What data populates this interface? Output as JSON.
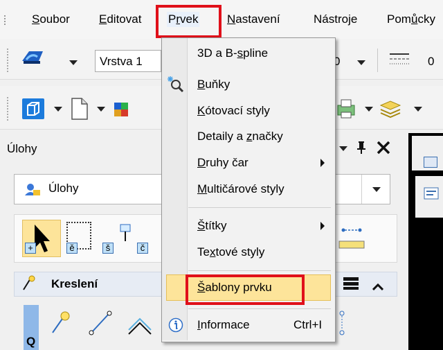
{
  "menubar": {
    "items": [
      {
        "pre": "",
        "u": "S",
        "post": "oubor"
      },
      {
        "pre": "",
        "u": "E",
        "post": "ditovat"
      },
      {
        "pre": "P",
        "u": "r",
        "post": "vek"
      },
      {
        "pre": "",
        "u": "N",
        "post": "astavení"
      },
      {
        "pre": "Nástro",
        "u": "j",
        "post": "e"
      },
      {
        "pre": "Pom",
        "u": "ů",
        "post": "cky"
      }
    ]
  },
  "toolbar1": {
    "layer_combo": "Vrstva 1",
    "value_a": "0",
    "value_b": "0"
  },
  "panel": {
    "title": "Úlohy",
    "combo_value": "Úlohy",
    "tool_labels": [
      "+",
      "ě",
      "š",
      "č"
    ],
    "section_title": "Kreslení",
    "bottom_letter": "Q"
  },
  "menu": {
    "items": [
      {
        "pre": "3D a B-",
        "u": "s",
        "post": "pline",
        "shortcut": "",
        "submenu": false
      },
      {
        "pre": "",
        "u": "B",
        "post": "uňky",
        "shortcut": "",
        "submenu": false
      },
      {
        "pre": "",
        "u": "K",
        "post": "ótovací styly",
        "shortcut": "",
        "submenu": false
      },
      {
        "pre": "Detaily a ",
        "u": "z",
        "post": "načky",
        "shortcut": "",
        "submenu": false
      },
      {
        "pre": "",
        "u": "D",
        "post": "ruhy čar",
        "shortcut": "",
        "submenu": true
      },
      {
        "pre": "",
        "u": "M",
        "post": "ultičárové styly",
        "shortcut": "",
        "submenu": false
      },
      {
        "pre": "",
        "u": "Š",
        "post": "títky",
        "shortcut": "",
        "submenu": true
      },
      {
        "pre": "Te",
        "u": "x",
        "post": "tové styly",
        "shortcut": "",
        "submenu": false
      },
      {
        "pre": "",
        "u": "Š",
        "post": "ablony prvku",
        "shortcut": "",
        "submenu": false
      },
      {
        "pre": "",
        "u": "I",
        "post": "nformace",
        "shortcut": "Ctrl+I",
        "submenu": false
      }
    ]
  },
  "colors": {
    "highlight_border": "#e0101a",
    "selected_bg": "#fde49a"
  }
}
